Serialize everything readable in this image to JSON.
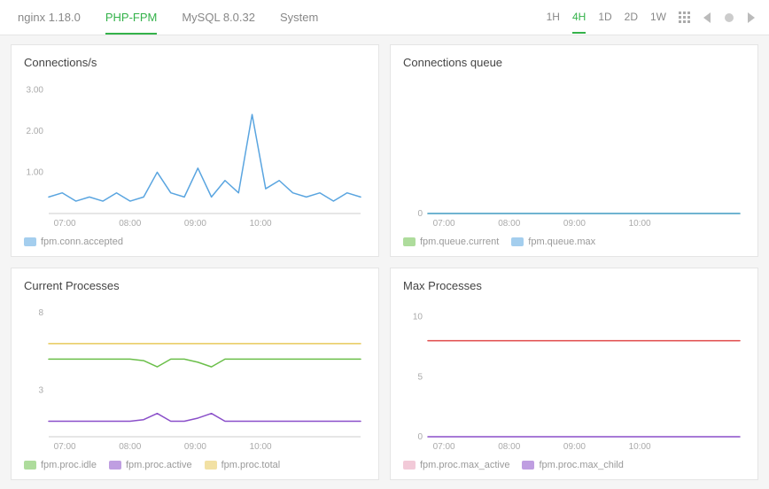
{
  "tabs": {
    "items": [
      {
        "label": "nginx 1.18.0",
        "active": false
      },
      {
        "label": "PHP-FPM",
        "active": true
      },
      {
        "label": "MySQL 8.0.32",
        "active": false
      },
      {
        "label": "System",
        "active": false
      }
    ]
  },
  "timerange": {
    "items": [
      {
        "label": "1H",
        "active": false
      },
      {
        "label": "4H",
        "active": true
      },
      {
        "label": "1D",
        "active": false
      },
      {
        "label": "2D",
        "active": false
      },
      {
        "label": "1W",
        "active": false
      }
    ]
  },
  "colors": {
    "blue": "#5aa5e0",
    "green": "#6bbf4a",
    "green2": "#4aa53a",
    "purple": "#8a4fc9",
    "yellow": "#e8c95a",
    "red": "#e04a4a",
    "pink": "#e79fb8",
    "grid": "#e5e5e5",
    "axis": "#ccc",
    "tick": "#aaa"
  },
  "panels": [
    {
      "title": "Connections/s",
      "xticks": [
        "07:00",
        "08:00",
        "09:00",
        "10:00"
      ],
      "yticks": [
        "1.00",
        "2.00",
        "3.00"
      ],
      "series_legend": [
        {
          "name": "fpm.conn.accepted",
          "color": "#5aa5e0"
        }
      ]
    },
    {
      "title": "Connections queue",
      "xticks": [
        "07:00",
        "08:00",
        "09:00",
        "10:00"
      ],
      "yticks": [
        "0"
      ],
      "series_legend": [
        {
          "name": "fpm.queue.current",
          "color": "#6bbf4a"
        },
        {
          "name": "fpm.queue.max",
          "color": "#5aa5e0"
        }
      ]
    },
    {
      "title": "Current Processes",
      "xticks": [
        "07:00",
        "08:00",
        "09:00",
        "10:00"
      ],
      "yticks": [
        "3",
        "8"
      ],
      "series_legend": [
        {
          "name": "fpm.proc.idle",
          "color": "#6bbf4a"
        },
        {
          "name": "fpm.proc.active",
          "color": "#8a4fc9"
        },
        {
          "name": "fpm.proc.total",
          "color": "#e8c95a"
        }
      ]
    },
    {
      "title": "Max Processes",
      "xticks": [
        "07:00",
        "08:00",
        "09:00",
        "10:00"
      ],
      "yticks": [
        "0",
        "5",
        "10"
      ],
      "series_legend": [
        {
          "name": "fpm.proc.max_active",
          "color": "#e79fb8"
        },
        {
          "name": "fpm.proc.max_child",
          "color": "#8a4fc9"
        }
      ]
    }
  ],
  "chart_data": [
    {
      "type": "line",
      "title": "Connections/s",
      "xlabel": "",
      "ylabel": "",
      "ylim": [
        0,
        3.2
      ],
      "x": [
        "06:40",
        "06:50",
        "07:00",
        "07:10",
        "07:20",
        "07:30",
        "07:40",
        "07:50",
        "08:00",
        "08:10",
        "08:20",
        "08:30",
        "08:40",
        "08:50",
        "09:00",
        "09:10",
        "09:20",
        "09:30",
        "09:40",
        "09:50",
        "10:00",
        "10:10",
        "10:20",
        "10:30"
      ],
      "series": [
        {
          "name": "fpm.conn.accepted",
          "color": "#5aa5e0",
          "values": [
            0.4,
            0.5,
            0.3,
            0.4,
            0.3,
            0.5,
            0.3,
            0.4,
            1.0,
            0.5,
            0.4,
            1.1,
            0.4,
            0.8,
            0.5,
            2.4,
            0.6,
            0.8,
            0.5,
            0.4,
            0.5,
            0.3,
            0.5,
            0.4
          ]
        }
      ]
    },
    {
      "type": "line",
      "title": "Connections queue",
      "xlabel": "",
      "ylabel": "",
      "ylim": [
        0,
        1
      ],
      "x": [
        "06:40",
        "10:30"
      ],
      "series": [
        {
          "name": "fpm.queue.current",
          "color": "#6bbf4a",
          "values": [
            0,
            0
          ]
        },
        {
          "name": "fpm.queue.max",
          "color": "#5aa5e0",
          "values": [
            0,
            0
          ]
        }
      ]
    },
    {
      "type": "line",
      "title": "Current Processes",
      "xlabel": "",
      "ylabel": "",
      "ylim": [
        0,
        8.5
      ],
      "x": [
        "06:40",
        "06:50",
        "07:00",
        "07:10",
        "07:20",
        "07:30",
        "07:40",
        "07:50",
        "08:00",
        "08:10",
        "08:20",
        "08:30",
        "08:40",
        "08:50",
        "09:00",
        "09:10",
        "09:20",
        "09:30",
        "09:40",
        "09:50",
        "10:00",
        "10:10",
        "10:20",
        "10:30"
      ],
      "series": [
        {
          "name": "fpm.proc.idle",
          "color": "#6bbf4a",
          "values": [
            5.0,
            5.0,
            5.0,
            5.0,
            5.0,
            5.0,
            5.0,
            4.9,
            4.5,
            5.0,
            5.0,
            4.8,
            4.5,
            5.0,
            5.0,
            5.0,
            5.0,
            5.0,
            5.0,
            5.0,
            5.0,
            5.0,
            5.0,
            5.0
          ]
        },
        {
          "name": "fpm.proc.active",
          "color": "#8a4fc9",
          "values": [
            1.0,
            1.0,
            1.0,
            1.0,
            1.0,
            1.0,
            1.0,
            1.1,
            1.5,
            1.0,
            1.0,
            1.2,
            1.5,
            1.0,
            1.0,
            1.0,
            1.0,
            1.0,
            1.0,
            1.0,
            1.0,
            1.0,
            1.0,
            1.0
          ]
        },
        {
          "name": "fpm.proc.total",
          "color": "#e8c95a",
          "values": [
            6.0,
            6.0,
            6.0,
            6.0,
            6.0,
            6.0,
            6.0,
            6.0,
            6.0,
            6.0,
            6.0,
            6.0,
            6.0,
            6.0,
            6.0,
            6.0,
            6.0,
            6.0,
            6.0,
            6.0,
            6.0,
            6.0,
            6.0,
            6.0
          ]
        }
      ]
    },
    {
      "type": "line",
      "title": "Max Processes",
      "xlabel": "",
      "ylabel": "",
      "ylim": [
        0,
        11
      ],
      "x": [
        "06:40",
        "10:30"
      ],
      "series": [
        {
          "name": "fpm.proc.max_active",
          "color": "#e04a4a",
          "values": [
            8,
            8
          ]
        },
        {
          "name": "fpm.proc.max_child",
          "color": "#8a4fc9",
          "values": [
            0,
            0
          ]
        }
      ]
    }
  ]
}
